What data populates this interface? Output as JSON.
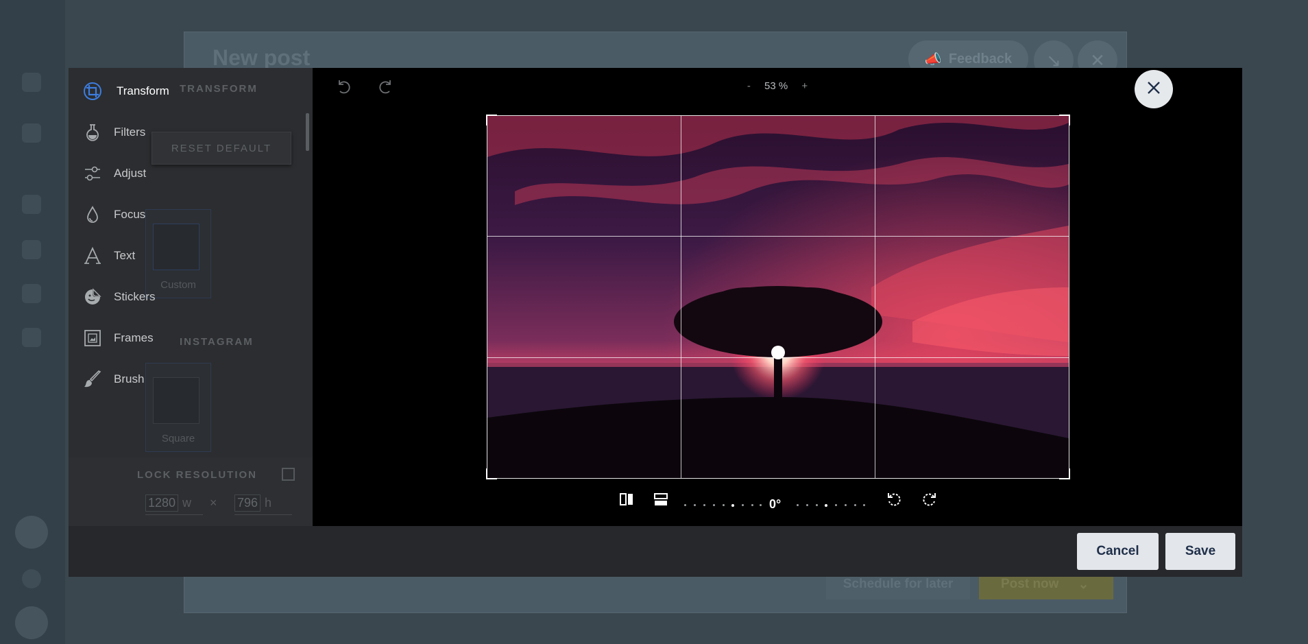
{
  "background_app": {
    "title": "New post",
    "feedback_label": "Feedback",
    "schedule_label": "Schedule for later",
    "post_label": "Post now"
  },
  "ghost_panel": {
    "section_transform": "TRANSFORM",
    "reset_label": "RESET DEFAULT",
    "custom_label": "Custom",
    "section_instagram": "INSTAGRAM",
    "square_label": "Square",
    "lock_label": "LOCK RESOLUTION",
    "width_value": "1280",
    "width_unit": "w",
    "times": "×",
    "height_value": "796",
    "height_unit": "h"
  },
  "menu": {
    "items": [
      {
        "label": "Transform",
        "icon": "crop-icon"
      },
      {
        "label": "Filters",
        "icon": "filter-flask-icon"
      },
      {
        "label": "Adjust",
        "icon": "sliders-icon"
      },
      {
        "label": "Focus",
        "icon": "droplet-icon"
      },
      {
        "label": "Text",
        "icon": "text-icon"
      },
      {
        "label": "Stickers",
        "icon": "sticker-icon"
      },
      {
        "label": "Frames",
        "icon": "frame-icon"
      },
      {
        "label": "Brush",
        "icon": "brush-icon"
      }
    ]
  },
  "toolbar": {
    "zoom_minus": "-",
    "zoom_value": "53 %",
    "zoom_plus": "+"
  },
  "rotation": {
    "angle": "0°"
  },
  "footer": {
    "cancel_label": "Cancel",
    "save_label": "Save"
  },
  "colors": {
    "accent": "#3d7de0",
    "button_bg": "#e3e6ea",
    "button_text": "#1f2f4a"
  }
}
